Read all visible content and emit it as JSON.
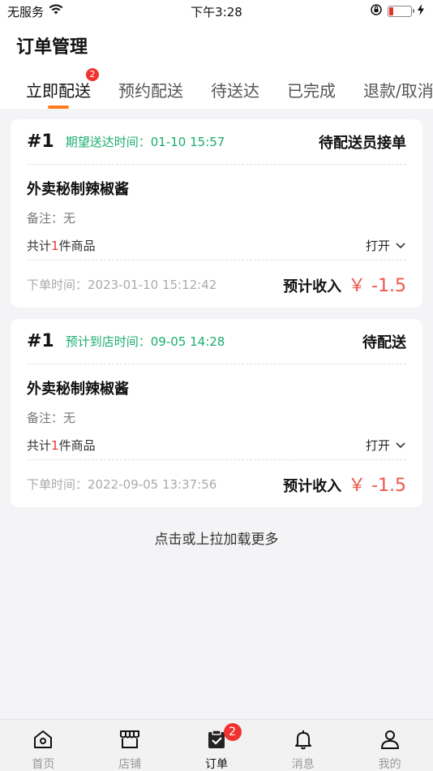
{
  "status_bar": {
    "carrier": "无服务",
    "time": "下午3:28",
    "battery_level": 0.2
  },
  "page": {
    "title": "订单管理"
  },
  "tabs": [
    {
      "label": "立即配送",
      "badge": "2",
      "active": true
    },
    {
      "label": "预约配送"
    },
    {
      "label": "待送达"
    },
    {
      "label": "已完成"
    },
    {
      "label": "退款/取消"
    }
  ],
  "orders": [
    {
      "number": "#1",
      "expect": "期望送达时间：01-10 15:57",
      "state": "待配送员接单",
      "product": "外卖秘制辣椒酱",
      "note": "备注：无",
      "count_prefix": "共计",
      "count": "1",
      "count_suffix": "件商品",
      "toggle": "打开",
      "order_time": "下单时间：2023-01-10 15:12:42",
      "income_label": "预计收入",
      "income": "￥ -1.5"
    },
    {
      "number": "#1",
      "expect": "预计到店时间：09-05 14:28",
      "state": "待配送",
      "product": "外卖秘制辣椒酱",
      "note": "备注：无",
      "count_prefix": "共计",
      "count": "1",
      "count_suffix": "件商品",
      "toggle": "打开",
      "order_time": "下单时间：2022-09-05 13:37:56",
      "income_label": "预计收入",
      "income": "￥ -1.5"
    }
  ],
  "load_more": "点击或上拉加载更多",
  "tabbar": [
    {
      "label": "首页",
      "icon": "home-icon"
    },
    {
      "label": "店铺",
      "icon": "store-icon"
    },
    {
      "label": "订单",
      "icon": "order-icon",
      "badge": "2",
      "active": true
    },
    {
      "label": "消息",
      "icon": "bell-icon"
    },
    {
      "label": "我的",
      "icon": "user-icon"
    }
  ],
  "colors": {
    "accent": "#ff7a1a",
    "green": "#1aae6f",
    "red": "#f0332f",
    "price": "#f0564a"
  }
}
